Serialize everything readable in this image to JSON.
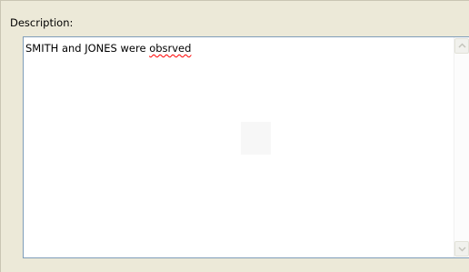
{
  "field": {
    "label": "Description:",
    "text_before": "SMITH and JONES were ",
    "misspelled_word": "obsrved"
  },
  "scrollbar": {
    "up_icon": "chevron-up-icon",
    "down_icon": "chevron-down-icon"
  },
  "colors": {
    "panel_bg": "#ece9d8",
    "field_border": "#7f9db9",
    "spellcheck_underline": "#ff0000"
  }
}
